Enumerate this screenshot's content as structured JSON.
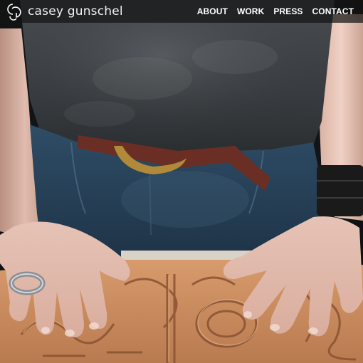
{
  "brand": {
    "name": "casey gunschel"
  },
  "nav": {
    "items": [
      "ABOUT",
      "WORK",
      "PRESS",
      "CONTACT"
    ]
  },
  "hero": {
    "image_subject": "person in grey t-shirt and jeans leaning over a hand-carved leather panel",
    "ring_icon": "ring-icon",
    "cuff_icon": "leather-cuff-icon"
  },
  "colors": {
    "topbar_bg": "#141414",
    "nav_text": "#ffffff",
    "leather": "#c68a5e",
    "shirt": "#3a3e42",
    "denim": "#2d4a62",
    "skin": "#e8c2b4"
  }
}
